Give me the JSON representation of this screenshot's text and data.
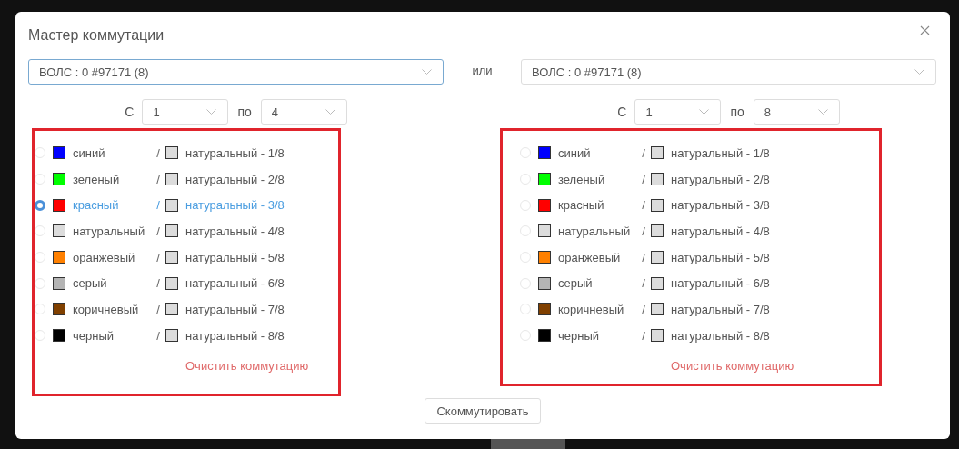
{
  "dialog": {
    "title": "Мастер коммутации",
    "or_label": "или",
    "submit_button": "Скоммутировать"
  },
  "sides": [
    {
      "cable_select": {
        "value": "ВОЛС : 0 #97171 (8)",
        "focused": true
      },
      "from_label": "С",
      "from_value": "1",
      "to_label": "по",
      "to_value": "4",
      "clear_link": "Очистить коммутацию",
      "fibers": [
        {
          "name": "синий",
          "color": "#0000ff",
          "separator": "/",
          "pair_name": "натуральный - 1/8",
          "selected": false
        },
        {
          "name": "зеленый",
          "color": "#00ff00",
          "separator": "/",
          "pair_name": "натуральный - 2/8",
          "selected": false
        },
        {
          "name": "красный",
          "color": "#ff0000",
          "separator": "/",
          "pair_name": "натуральный - 3/8",
          "selected": true
        },
        {
          "name": "натуральный",
          "color": "#dcdcdc",
          "separator": "/",
          "pair_name": "натуральный - 4/8",
          "selected": false
        },
        {
          "name": "оранжевый",
          "color": "#ff8000",
          "separator": "/",
          "pair_name": "натуральный - 5/8",
          "selected": false
        },
        {
          "name": "серый",
          "color": "#b4b4b4",
          "separator": "/",
          "pair_name": "натуральный - 6/8",
          "selected": false
        },
        {
          "name": "коричневый",
          "color": "#804000",
          "separator": "/",
          "pair_name": "натуральный - 7/8",
          "selected": false
        },
        {
          "name": "черный",
          "color": "#000000",
          "separator": "/",
          "pair_name": "натуральный - 8/8",
          "selected": false
        }
      ]
    },
    {
      "cable_select": {
        "value": "ВОЛС : 0 #97171 (8)",
        "focused": false
      },
      "from_label": "С",
      "from_value": "1",
      "to_label": "по",
      "to_value": "8",
      "clear_link": "Очистить коммутацию",
      "fibers": [
        {
          "name": "синий",
          "color": "#0000ff",
          "separator": "/",
          "pair_name": "натуральный - 1/8",
          "selected": false
        },
        {
          "name": "зеленый",
          "color": "#00ff00",
          "separator": "/",
          "pair_name": "натуральный - 2/8",
          "selected": false
        },
        {
          "name": "красный",
          "color": "#ff0000",
          "separator": "/",
          "pair_name": "натуральный - 3/8",
          "selected": false
        },
        {
          "name": "натуральный",
          "color": "#dcdcdc",
          "separator": "/",
          "pair_name": "натуральный - 4/8",
          "selected": false
        },
        {
          "name": "оранжевый",
          "color": "#ff8000",
          "separator": "/",
          "pair_name": "натуральный - 5/8",
          "selected": false
        },
        {
          "name": "серый",
          "color": "#b4b4b4",
          "separator": "/",
          "pair_name": "натуральный - 6/8",
          "selected": false
        },
        {
          "name": "коричневый",
          "color": "#804000",
          "separator": "/",
          "pair_name": "натуральный - 7/8",
          "selected": false
        },
        {
          "name": "черный",
          "color": "#000000",
          "separator": "/",
          "pair_name": "натуральный - 8/8",
          "selected": false
        }
      ]
    }
  ]
}
